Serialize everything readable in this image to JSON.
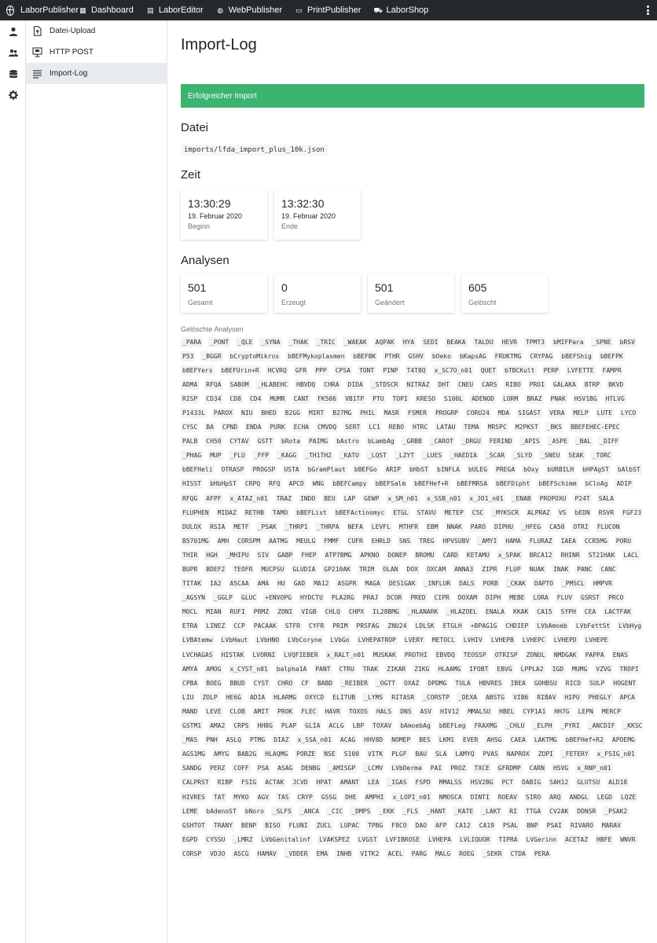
{
  "topbar": {
    "brand": "LaborPublisher",
    "items": [
      {
        "label": "Dashboard",
        "icon": "dashboard-icon"
      },
      {
        "label": "LaborEditor",
        "icon": "document-icon"
      },
      {
        "label": "WebPublisher",
        "icon": "globe-icon"
      },
      {
        "label": "PrintPublisher",
        "icon": "window-icon"
      },
      {
        "label": "LaborShop",
        "icon": "cart-icon"
      }
    ]
  },
  "sidebar": {
    "items": [
      {
        "label": "Datei-Upload",
        "icon": "file-upload-icon"
      },
      {
        "label": "HTTP POST",
        "icon": "monitor-icon"
      },
      {
        "label": "Import-Log",
        "icon": "list-icon"
      }
    ]
  },
  "page": {
    "title": "Import-Log",
    "alert": "Erfolgreicher Import",
    "file_heading": "Datei",
    "file_path": "imports/lfda_import_plus_10k.json",
    "time_heading": "Zeit",
    "start": {
      "time": "13:30:29",
      "date": "19. Februar 2020",
      "label": "Beginn"
    },
    "end": {
      "time": "13:32:30",
      "date": "19. Februar 2020",
      "label": "Ende"
    },
    "analyses_heading": "Analysen",
    "stats": [
      {
        "value": "501",
        "label": "Gesamt"
      },
      {
        "value": "0",
        "label": "Erzeugt"
      },
      {
        "value": "501",
        "label": "Geändert"
      },
      {
        "value": "605",
        "label": "Gelöscht"
      }
    ],
    "deleted_heading": "Gelöschte Analysen",
    "deleted": [
      "_PARA",
      "_PONT",
      "_QLE",
      "_SYNA",
      "_THAK",
      "_TRIC",
      "_WAEAK",
      "AQPAK",
      "HYA",
      "SEDI",
      "BEAKA",
      "TALDU",
      "HEVR",
      "TPMT3",
      "bMIFPara",
      "_SPNE",
      "bRSV",
      "P53",
      "_BGGR",
      "bCryptoMikros",
      "bBEFMykoplasmen",
      "bBEFBK",
      "PTHR",
      "GSHV",
      "bOeko",
      "bKapsAG",
      "FRUKTMG",
      "CRYPAG",
      "bBEFShig",
      "bBEFPK",
      "bBEFYers",
      "bBEFUrin+R",
      "HCVRQ",
      "GFR",
      "PPP",
      "CPSA",
      "TONT",
      "PINP",
      "T4T8Q",
      "x_SC7O_n01",
      "QUET",
      "bTBCKult",
      "PERP",
      "LVFETTE",
      "FAMPR",
      "ADMA",
      "RFQA",
      "SABOM",
      "_HLABEHC",
      "HBVDQ",
      "CHRA",
      "DIDA",
      "_STDSCR",
      "NITRAZ",
      "DHT",
      "CNEU",
      "CARS",
      "RIBO",
      "PROI",
      "GALAKA",
      "BTRP",
      "BKVD",
      "RISP",
      "CD34",
      "CD8",
      "CD4",
      "MUMR",
      "CANT",
      "FK506",
      "VB1TP",
      "PTU",
      "TOPI",
      "KRESO",
      "S100L",
      "ADENOD",
      "LORM",
      "BRAZ",
      "PNAK",
      "HSV1BG",
      "HTLVG",
      "P1433L",
      "PAROX",
      "NIU",
      "BHED",
      "B2GG",
      "MIRT",
      "B27MG",
      "PHIL",
      "MASR",
      "FSMER",
      "PROGRP",
      "CORU24",
      "MDA",
      "SIGAST",
      "VERA",
      "MELP",
      "LUTE",
      "LYCO",
      "CYSC",
      "BA",
      "CPND",
      "ENDA",
      "PURK",
      "ECHA",
      "CMVDQ",
      "SERT",
      "LC1",
      "REBO",
      "HTRC",
      "LATAU",
      "TEMA",
      "MRSPC",
      "M2PKST",
      "_BKS",
      "BBEFEHEC-EPEC",
      "PALB",
      "CH50",
      "CYTAV",
      "GSTT",
      "bRota",
      "PAIMG",
      "bAstro",
      "bLambAg",
      "_GRBB",
      "_CAROT",
      "_DRGU",
      "FERIND",
      "_APIS",
      "_ASPE",
      "_BAL",
      "_DIFF",
      "_PHAG",
      "MUP",
      "_FLU",
      "_FFP",
      "_KAGG",
      "_TH1TH2",
      "_KATU",
      "_LQST",
      "_LZYT",
      "_LUES",
      "_HAEDIA",
      "_SCAR",
      "_SLYD",
      "_SNEU",
      "SEAK",
      "_TORC",
      "bBEFHeli",
      "OTRASP",
      "PROGSP",
      "USTA",
      "bGramPlaut",
      "bBEFGo",
      "ARIP",
      "bHbST",
      "bINFLA",
      "bULEG",
      "PREGA",
      "bOxy",
      "bURBILH",
      "bHPAgST",
      "bAlbST",
      "HISST",
      "bHbHpST",
      "CRPQ",
      "RFQ",
      "APCD",
      "WNG",
      "bBEFCampy",
      "bBEFSalm",
      "bBEFHef+R",
      "bBEFMRSA",
      "bBEFDipht",
      "bBEFSchimm",
      "bCloAg",
      "ADIP",
      "RFQG",
      "AFPF",
      "x_ATAZ_n01",
      "TRAZ",
      "INDO",
      "BEU",
      "LAP",
      "GEWP",
      "x_SM_n01",
      "x_SSB_n01",
      "x_JO1_n01",
      "_ENAB",
      "PROPOXU",
      "P24T",
      "SALA",
      "FLUPHEN",
      "MIDAZ",
      "RETHB",
      "TAMO",
      "bBEFList",
      "bBEFActinomyc",
      "ETGL",
      "STAVU",
      "METEP",
      "C5C",
      "_MYKSCR",
      "ALPRAZ",
      "VS",
      "bEDN",
      "RSVR",
      "FGF23",
      "DULOX",
      "RSIA",
      "METF",
      "_PSAK",
      "_THRP1",
      "_THRPA",
      "NEFA",
      "LEVFL",
      "MTHFR",
      "EBM",
      "NNAK",
      "PARO",
      "DIPHU",
      "_HFEG",
      "CA50",
      "OTRI",
      "FLUCON",
      "B5701MG",
      "AMH",
      "CORSPM",
      "AATMG",
      "MEULG",
      "FMMF",
      "CUFR",
      "EHRLD",
      "SNS",
      "TREG",
      "HPVSUBV",
      "_AMYI",
      "HAMA",
      "FLURAZ",
      "IAEA",
      "CCR5MG",
      "PORU",
      "THIR",
      "HGH",
      "_MHIPU",
      "SIV",
      "GABP",
      "FHEP",
      "ATP7BMG",
      "APKNO",
      "DONEP",
      "BROMU",
      "CARD",
      "KETAMU",
      "x_SPAK",
      "BRCA12",
      "RHINR",
      "ST21HAK",
      "LACL",
      "BUPR",
      "BDEF2",
      "TEOFR",
      "MUCPSU",
      "GLUDIA",
      "GP210AK",
      "TRIM",
      "OLAN",
      "DOX",
      "OXCAM",
      "ANNA3",
      "ZIPR",
      "FLUP",
      "NUAK",
      "INAK",
      "PANC",
      "CANC",
      "TITAK",
      "IA2",
      "ASCAA",
      "AMA",
      "HU",
      "GAD",
      "MA12",
      "ASGPR",
      "MAGA",
      "DES1GAK",
      "_INFLUR",
      "DALS",
      "PORB",
      "_CKAK",
      "DAPTO",
      "_PMSCL",
      "HMPVR",
      "_AGSYN",
      "_GGLP",
      "GLUC",
      "+ENVOPG",
      "HYDCTU",
      "PLA2RG",
      "PRAJ",
      "DCOR",
      "PRED",
      "CIPR",
      "DOXAM",
      "DIPH",
      "MEBE",
      "LORA",
      "FLUV",
      "GSRST",
      "PRCO",
      "MOCL",
      "MIAN",
      "RUFI",
      "PRMZ",
      "ZONI",
      "VIGB",
      "CHLQ",
      "CHPX",
      "IL28BMG",
      "_HLANARK",
      "_HLAZOEL",
      "ENALA",
      "KKAK",
      "CA15",
      "SYPH",
      "CEA",
      "LACTFAK",
      "ETRA",
      "LINEZ",
      "CCP",
      "PACAAK",
      "STFR",
      "CYFR",
      "PRIM",
      "PRSFAG",
      "ZNU24",
      "LDLSK",
      "ETGLH",
      "+BPAG1G",
      "CHDIEP",
      "LVbAmoeb",
      "LVbFettSt",
      "LVbHyg",
      "LVBAtemw",
      "LVbHaut",
      "LVbHNO",
      "LVbCoryne",
      "LVbGo",
      "LVHEPATROP",
      "LVERY",
      "METOCL",
      "LVHIV",
      "LVHEPB",
      "LVHEPC",
      "LVHEPD",
      "LVHEPE",
      "LVCHAGAS",
      "HISTAK",
      "LVORNI",
      "LVQFIEBER",
      "x_RALT_n01",
      "MUSKAK",
      "PROTHI",
      "EBVDQ",
      "TEOSSP",
      "OTRISP",
      "ZONUL",
      "NMDGAK",
      "PAPPA",
      "ENAS",
      "AMYA",
      "AMOG",
      "x_CYST_n01",
      "balpha1A",
      "PANT",
      "CTRU",
      "TRAK",
      "ZIKAR",
      "ZIKG",
      "HLAAMG",
      "IFOBT",
      "EBVG",
      "LPPLA2",
      "IGD",
      "MUMG",
      "VZVG",
      "TROPI",
      "CPBA",
      "BOEG",
      "BBUD",
      "CYST",
      "CHRO",
      "CF",
      "BABD",
      "_REIBER",
      "_OGTT",
      "OXAZ",
      "DPDMG",
      "TULA",
      "HBVRES",
      "IBEA",
      "GOHBSU",
      "RICD",
      "SULP",
      "HOGENT",
      "LIU",
      "ZOLP",
      "HE6G",
      "ADIA",
      "HLARMG",
      "OXYCD",
      "ELITUB",
      "_LYMS",
      "RITASR",
      "_CORSTP",
      "_DEXA",
      "ABSTG",
      "VIB6",
      "RIBAV",
      "HIPU",
      "PHEGLY",
      "APCA",
      "MAND",
      "LEVE",
      "CLOB",
      "AMIT",
      "PROK",
      "FLEC",
      "HAVR",
      "TOXOS",
      "HALS",
      "DNS",
      "ASV",
      "HIV12",
      "MMALSU",
      "HBEL",
      "CYP1A1",
      "HH7G",
      "LEPN",
      "MERCP",
      "GSTM1",
      "AMA2",
      "CRPS",
      "HH8G",
      "PLAP",
      "GLIA",
      "ACLG",
      "LBP",
      "TOXAV",
      "bAmoebAg",
      "bBEFLeg",
      "FRAXMG",
      "_CHLU",
      "_ELPH",
      "_PYRI",
      "_ANCDIF",
      "_KKSC",
      "_MAS",
      "PNH",
      "ASLQ",
      "PTMG",
      "DIAZ",
      "x_SSA_n01",
      "ACAG",
      "HHV8D",
      "NOMEP",
      "BES",
      "LKM1",
      "EVER",
      "AHSG",
      "CAEA",
      "LAKTMG",
      "bBEFHef+R2",
      "APOEMG",
      "AGS1MG",
      "AMYG",
      "BAB2G",
      "HLAQMG",
      "PORZE",
      "NSE",
      "S100",
      "VITK",
      "PLGF",
      "BAU",
      "SLA",
      "LAMYQ",
      "PVAS",
      "NAPROX",
      "ZOPI",
      "_FETERY",
      "x_FSIG_n01",
      "SANDG",
      "PERZ",
      "COFF",
      "PSA",
      "ASAG",
      "DENBG",
      "_AMISGP",
      "_LCMV",
      "LVbDerma",
      "PAI",
      "PROZ",
      "TXCE",
      "GFRDMP",
      "CARN",
      "HSVG",
      "x_RNP_n01",
      "CALPRST",
      "RIBP",
      "FSIG",
      "ACTAK",
      "JCVD",
      "HPAT",
      "AMANT",
      "LEA",
      "_IGAS",
      "FSPD",
      "MMALSS",
      "HSV2BG",
      "PCT",
      "DABIG",
      "SAH12",
      "GLUTSU",
      "ALD18",
      "HIVRES",
      "TAT",
      "MYKO",
      "AGV",
      "TAS",
      "CRYP",
      "GSSG",
      "DHE",
      "AMPHI",
      "x_LOPI_n01",
      "NMOSCA",
      "DINTI",
      "ROEAV",
      "SIRO",
      "ARQ",
      "ANDGL",
      "LEGD",
      "LQZE",
      "LEME",
      "bAdenoST",
      "bNoro",
      "_SLFS",
      "_ANCA",
      "_CIC",
      "_DMPS",
      "_EKK",
      "_FLS",
      "_HANT",
      "_KATE",
      "_LAKT",
      "RI",
      "TTGA",
      "CV2AK",
      "DDNSR",
      "_PSAK2",
      "GSHTOT",
      "TRANY",
      "BENP",
      "BISO",
      "FLUNI",
      "ZUCL",
      "LUPAC",
      "TPBG",
      "F8CO",
      "DAO",
      "AFP",
      "CA12",
      "CA19",
      "PSAL",
      "BNP",
      "PSAI",
      "RIVARO",
      "MARAV",
      "EGPD",
      "CYSSU",
      "_LMRZ",
      "LVbGenitalinf",
      "LVAKSPEZ",
      "LVGST",
      "LVFIBROSE",
      "LVHEPA",
      "LVLIQUOR",
      "TIPRA",
      "LVGerinn",
      "ACETAZ",
      "HBFE",
      "WNVR",
      "CORSP",
      "VD3O",
      "ASCG",
      "HAMAV",
      "_VDDER",
      "EMA",
      "INHB",
      "VITK2",
      "ACEL",
      "PARG",
      "MALG",
      "ROEG",
      "_SEKR",
      "CTDA",
      "PERA"
    ]
  }
}
